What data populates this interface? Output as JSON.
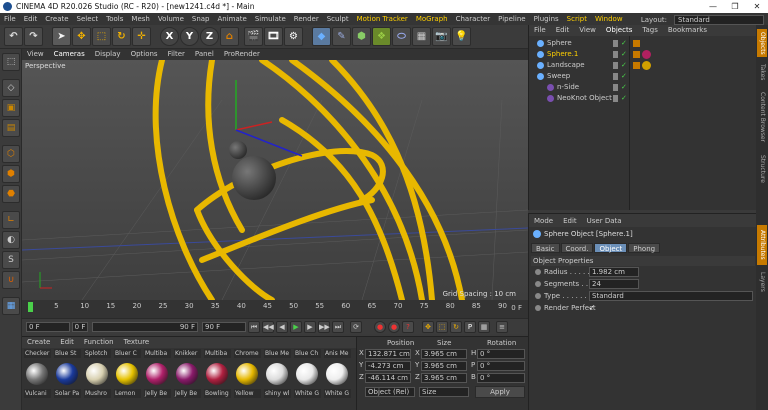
{
  "title": "CINEMA 4D R20.026 Studio (RC - R20) - [new1241.c4d *] - Main",
  "menu": [
    "File",
    "Edit",
    "Create",
    "Select",
    "Tools",
    "Mesh",
    "Volume",
    "Snap",
    "Animate",
    "Simulate",
    "Render",
    "Sculpt",
    "Motion Tracker",
    "MoGraph",
    "Character",
    "Pipeline",
    "Plugins",
    "Script",
    "Window"
  ],
  "layout_label": "Layout:",
  "layout_value": "Standard",
  "toolbar": {
    "x": "X",
    "y": "Y",
    "z": "Z"
  },
  "viewport": {
    "menu": [
      "View",
      "Cameras",
      "Display",
      "Options",
      "Filter",
      "Panel",
      "ProRender"
    ],
    "label": "Perspective",
    "grid_spacing": "Grid Spacing : 10 cm"
  },
  "timeline": {
    "ticks": [
      "0",
      "5",
      "10",
      "15",
      "20",
      "25",
      "30",
      "35",
      "40",
      "45",
      "50",
      "55",
      "60",
      "65",
      "70",
      "75",
      "80",
      "85",
      "90"
    ],
    "end": "0 F"
  },
  "transport": {
    "start": "0 F",
    "current": "0 F",
    "range_end": "90 F",
    "end": "90 F"
  },
  "materials": {
    "menu": [
      "Create",
      "Edit",
      "Function",
      "Texture"
    ],
    "row1": [
      "Checker",
      "Blue St",
      "Splotch",
      "Bluer C",
      "Multiba",
      "Knikker",
      "Multiba",
      "Chrome",
      "Blue Me",
      "Blue Ch",
      "Anis Me"
    ],
    "row2": [
      "Vulcani",
      "Solar Pa",
      "Mushro",
      "Lemon",
      "Jelly Be",
      "Jelly Be",
      "Bowling",
      "Yellow",
      "shiny wl",
      "White G",
      "White G"
    ],
    "colors": [
      "#777777",
      "#1a3a9c",
      "#d8d0b0",
      "#e6c200",
      "#b0206a",
      "#8a1a6a",
      "#b02040",
      "#e6b800",
      "#dcdcdc",
      "#e8e8e8",
      "#eeeeee"
    ]
  },
  "coords": {
    "headers": [
      "Position",
      "Size",
      "Rotation"
    ],
    "rows": [
      {
        "axis": "X",
        "pos": "132.871 cm",
        "sizeAxis": "X",
        "size": "3.965 cm",
        "rotAxis": "H",
        "rot": "0 °"
      },
      {
        "axis": "Y",
        "pos": "-4.273 cm",
        "sizeAxis": "Y",
        "size": "3.965 cm",
        "rotAxis": "P",
        "rot": "0 °"
      },
      {
        "axis": "Z",
        "pos": "-46.114 cm",
        "sizeAxis": "Z",
        "size": "3.965 cm",
        "rotAxis": "B",
        "rot": "0 °"
      }
    ],
    "mode": "Object (Rel)",
    "size_mode": "Size",
    "apply": "Apply"
  },
  "objects": {
    "menu": [
      "File",
      "Edit",
      "View",
      "Objects",
      "Tags",
      "Bookmarks"
    ],
    "items": [
      {
        "name": "Sphere",
        "indent": 0,
        "color": "#cccccc"
      },
      {
        "name": "Sphere.1",
        "indent": 0,
        "color": "#ffd000"
      },
      {
        "name": "Landscape",
        "indent": 0,
        "color": "#cccccc"
      },
      {
        "name": "Sweep",
        "indent": 0,
        "color": "#cccccc"
      },
      {
        "name": "n-Side",
        "indent": 1,
        "color": "#cccccc"
      },
      {
        "name": "NeoKnot Object",
        "indent": 1,
        "color": "#cccccc"
      }
    ]
  },
  "attributes": {
    "menu": [
      "Mode",
      "Edit",
      "User Data"
    ],
    "header": "Sphere Object [Sphere.1]",
    "tabs": [
      "Basic",
      "Coord.",
      "Object",
      "Phong"
    ],
    "section": "Object Properties",
    "radius_label": "Radius . . . . . .",
    "radius": "1.982 cm",
    "segments_label": "Segments . . .",
    "segments": "24",
    "type_label": "Type . . . . . . .",
    "type": "Standard",
    "render_perfect_label": "Render Perfect",
    "render_perfect": "✓"
  },
  "sidetabs": [
    "Objects",
    "Takes",
    "Content Browser",
    "Structure",
    "Attributes",
    "Layers"
  ]
}
